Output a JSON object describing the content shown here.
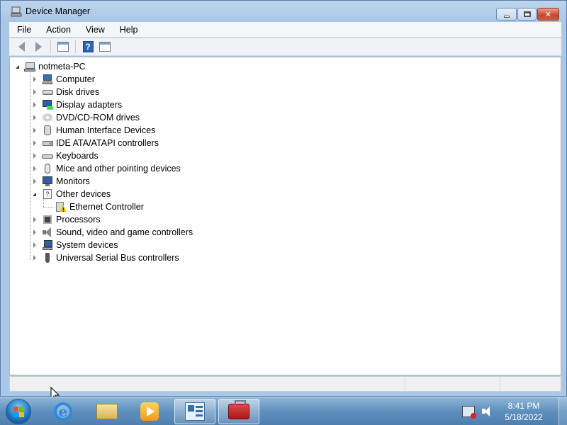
{
  "window": {
    "title": "Device Manager",
    "controls": {
      "minimize": "",
      "maximize": "",
      "close": "✕"
    }
  },
  "menu": [
    "File",
    "Action",
    "View",
    "Help"
  ],
  "toolbar": {
    "buttons": [
      "back-icon",
      "forward-icon",
      "show-hide-console-tree-icon",
      "help-icon",
      "properties-icon"
    ],
    "help_label": "?"
  },
  "tree": {
    "root": "notmeta-PC",
    "items": [
      {
        "label": "Computer",
        "icon": "computer-icon",
        "expanded": false
      },
      {
        "label": "Disk drives",
        "icon": "disk-drive-icon",
        "expanded": false
      },
      {
        "label": "Display adapters",
        "icon": "display-adapter-icon",
        "expanded": false
      },
      {
        "label": "DVD/CD-ROM drives",
        "icon": "dvd-drive-icon",
        "expanded": false
      },
      {
        "label": "Human Interface Devices",
        "icon": "hid-icon",
        "expanded": false
      },
      {
        "label": "IDE ATA/ATAPI controllers",
        "icon": "ide-controller-icon",
        "expanded": false
      },
      {
        "label": "Keyboards",
        "icon": "keyboard-icon",
        "expanded": false
      },
      {
        "label": "Mice and other pointing devices",
        "icon": "mouse-icon",
        "expanded": false
      },
      {
        "label": "Monitors",
        "icon": "monitor-icon",
        "expanded": false
      },
      {
        "label": "Other devices",
        "icon": "other-devices-icon",
        "expanded": true,
        "children": [
          {
            "label": "Ethernet Controller",
            "icon": "warning-device-icon"
          }
        ]
      },
      {
        "label": "Processors",
        "icon": "processor-icon",
        "expanded": false
      },
      {
        "label": "Sound, video and game controllers",
        "icon": "sound-icon",
        "expanded": false
      },
      {
        "label": "System devices",
        "icon": "system-devices-icon",
        "expanded": false
      },
      {
        "label": "Universal Serial Bus controllers",
        "icon": "usb-icon",
        "expanded": false
      }
    ]
  },
  "taskbar": {
    "apps": [
      "internet-explorer-icon",
      "windows-explorer-icon",
      "media-player-icon",
      "device-manager-icon",
      "toolbox-icon"
    ],
    "active_app": "toolbox-icon",
    "clock": {
      "time": "8:41 PM",
      "date": "5/18/2022"
    },
    "ie_glyph": "e"
  }
}
